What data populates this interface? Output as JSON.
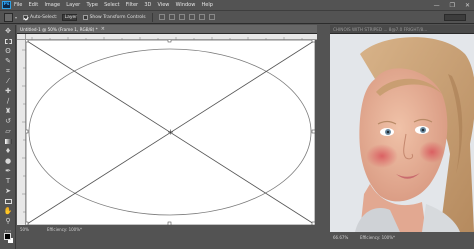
{
  "app": {
    "logo": "Ps"
  },
  "menu": [
    "File",
    "Edit",
    "Image",
    "Layer",
    "Type",
    "Select",
    "Filter",
    "3D",
    "View",
    "Window",
    "Help"
  ],
  "window_controls": [
    "—",
    "❐",
    "✕"
  ],
  "options": {
    "auto_select_label": "Auto-Select:",
    "auto_select_checked": true,
    "target": "Layer",
    "transform_label": "Show Transform Controls",
    "transform_checked": false
  },
  "documents": [
    {
      "title": "Untitled-1 @ 50% (Frame 1, RGB/8) *",
      "close": "×",
      "zoom": "50%",
      "info": "Efficiency: 100%*"
    },
    {
      "title": "CHINOIS WITH STRIPED ... 8@7.0 FRIGHT/8...",
      "close": "×",
      "zoom": "66.67%",
      "info": "Efficiency: 100%*"
    }
  ],
  "tools": [
    "move-icon",
    "marquee-icon",
    "lasso-icon",
    "quick-select-icon",
    "crop-icon",
    "eyedropper-icon",
    "healing-icon",
    "brush-icon",
    "clone-stamp-icon",
    "history-brush-icon",
    "eraser-icon",
    "gradient-icon",
    "blur-icon",
    "dodge-icon",
    "pen-icon",
    "type-icon",
    "path-select-icon",
    "rectangle-icon",
    "hand-icon",
    "zoom-icon",
    "more-icon"
  ],
  "colors": {
    "workspace": "#535353",
    "ruler": "#e8e8e8",
    "canvas": "#ffffff",
    "foreground": "#000000",
    "background": "#ffffff"
  }
}
